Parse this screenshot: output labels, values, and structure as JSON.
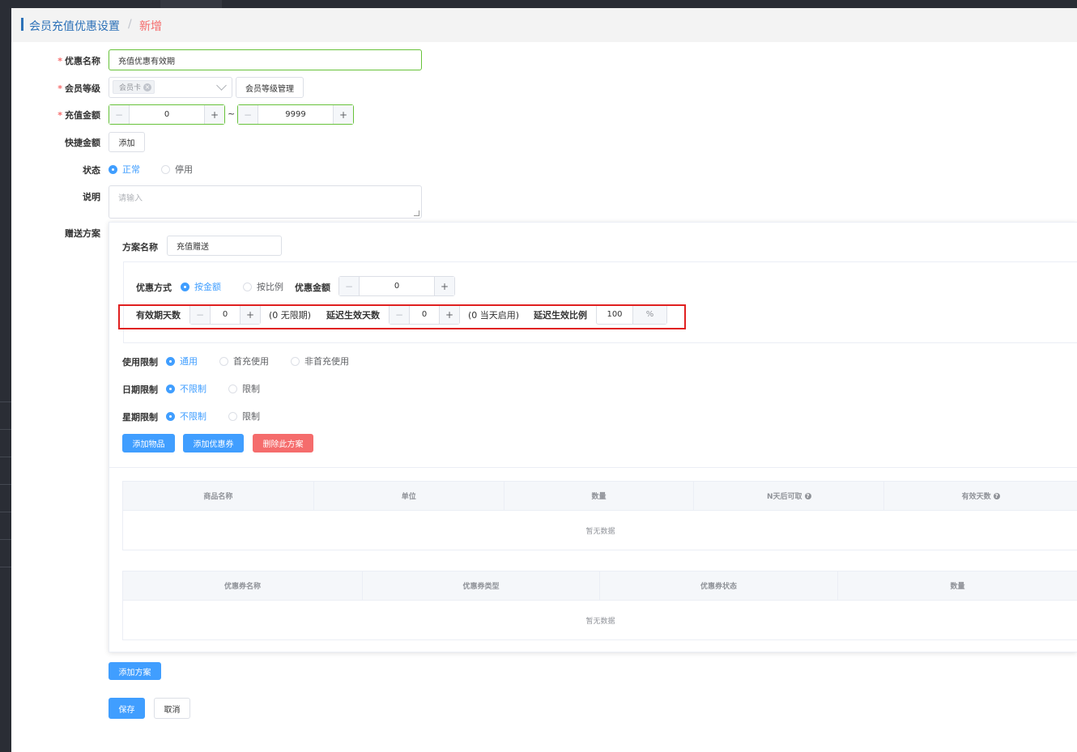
{
  "breadcrumb": {
    "parent": "会员充值优惠设置",
    "separator": "/",
    "current": "新增"
  },
  "form": {
    "name": {
      "label": "优惠名称",
      "required": true,
      "value": "充值优惠有效期"
    },
    "level": {
      "label": "会员等级",
      "required": true,
      "tag": "会员卡",
      "manage_button": "会员等级管理"
    },
    "amount": {
      "label": "充值金额",
      "required": true,
      "min": "0",
      "max": "9999",
      "tilde": "~"
    },
    "quick_amount": {
      "label": "快捷金额",
      "add_button": "添加"
    },
    "status": {
      "label": "状态",
      "options": [
        "正常",
        "停用"
      ],
      "selected": "正常"
    },
    "desc": {
      "label": "说明",
      "placeholder": "请输入"
    },
    "gift_label": "赠送方案"
  },
  "plan": {
    "name_label": "方案名称",
    "name_value": "充值赠送",
    "discount_mode": {
      "label": "优惠方式",
      "options": [
        "按金额",
        "按比例"
      ],
      "selected": "按金额"
    },
    "discount_amount": {
      "label": "优惠金额",
      "value": "0"
    },
    "valid_days": {
      "label": "有效期天数",
      "value": "0",
      "hint": "(0 无限期)"
    },
    "delay_days": {
      "label": "延迟生效天数",
      "value": "0",
      "hint": "(0 当天启用)"
    },
    "delay_ratio": {
      "label": "延迟生效比例",
      "value": "100",
      "unit": "%"
    },
    "usage_limit": {
      "label": "使用限制",
      "options": [
        "通用",
        "首充使用",
        "非首充使用"
      ],
      "selected": "通用"
    },
    "date_limit": {
      "label": "日期限制",
      "options": [
        "不限制",
        "限制"
      ],
      "selected": "不限制"
    },
    "week_limit": {
      "label": "星期限制",
      "options": [
        "不限制",
        "限制"
      ],
      "selected": "不限制"
    },
    "buttons": {
      "add_goods": "添加物品",
      "add_coupon": "添加优惠券",
      "delete_plan": "删除此方案"
    },
    "goods_table": {
      "columns": [
        "商品名称",
        "单位",
        "数量",
        "N天后可取",
        "有效天数"
      ],
      "empty": "暂无数据"
    },
    "coupon_table": {
      "columns": [
        "优惠券名称",
        "优惠券类型",
        "优惠券状态",
        "数量"
      ],
      "empty": "暂无数据"
    }
  },
  "footer": {
    "add_plan": "添加方案",
    "save": "保存",
    "cancel": "取消"
  },
  "colors": {
    "primary": "#409eff",
    "danger": "#f56c6c",
    "success_border": "#67c23a",
    "breadcrumb": "#2d72b8",
    "highlight_box": "#e02020"
  }
}
